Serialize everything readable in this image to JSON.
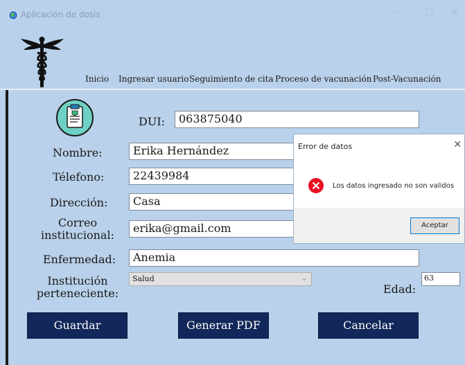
{
  "window": {
    "title": "Aplicación de dosis",
    "minimize_glyph": "—",
    "maximize_glyph": "☐",
    "close_glyph": "✕"
  },
  "nav": {
    "items": [
      "Inicio",
      "Ingresar usuario",
      "Seguimiento de cita",
      "Proceso de vacunación",
      "Post-Vacunación"
    ]
  },
  "form": {
    "dui": {
      "label": "DUI:",
      "value": "063875040"
    },
    "nombre": {
      "label": "Nombre:",
      "value": "Erika Hernández"
    },
    "telefono": {
      "label": "Télefono:",
      "value": "22439984"
    },
    "direccion": {
      "label": "Dirección:",
      "value": "Casa"
    },
    "correo": {
      "label_line1": "Correo",
      "label_line2": "institucional:",
      "value": "erika@gmail.com"
    },
    "enfermedad": {
      "label": "Enfermedad:",
      "value": "Anemia"
    },
    "institucion": {
      "label_line1": "Institución",
      "label_line2": "perteneciente:",
      "value": "Salud"
    },
    "edad": {
      "label": "Edad:",
      "value": "63"
    }
  },
  "buttons": {
    "guardar": "Guardar",
    "pdf": "Generar PDF",
    "cancelar": "Cancelar"
  },
  "dialog": {
    "title": "Error de datos",
    "close_glyph": "✕",
    "message": "Los datos ingresado no son validos",
    "ok": "Aceptar"
  },
  "colors": {
    "background": "#b9d1ea",
    "button": "#13285a",
    "error": "#e81123"
  }
}
